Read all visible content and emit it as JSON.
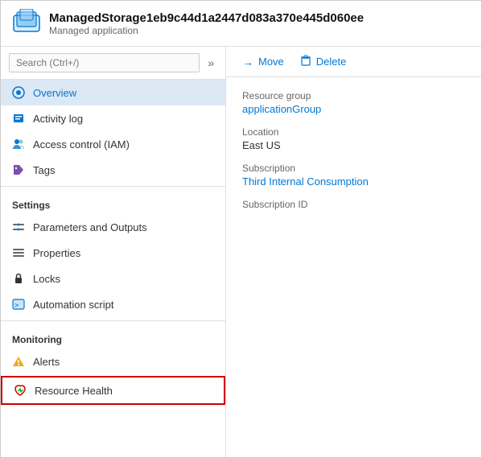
{
  "header": {
    "title": "ManagedStorage1eb9c44d1a2447d083a370e445d060ee",
    "subtitle": "Managed application",
    "icon_label": "managed-application-icon"
  },
  "sidebar": {
    "search_placeholder": "Search (Ctrl+/)",
    "collapse_label": "»",
    "nav_items": [
      {
        "id": "overview",
        "label": "Overview",
        "icon": "overview",
        "active": true,
        "highlighted": false
      },
      {
        "id": "activity-log",
        "label": "Activity log",
        "icon": "activity",
        "active": false,
        "highlighted": false
      },
      {
        "id": "access-control",
        "label": "Access control (IAM)",
        "icon": "iam",
        "active": false,
        "highlighted": false
      },
      {
        "id": "tags",
        "label": "Tags",
        "icon": "tags",
        "active": false,
        "highlighted": false
      }
    ],
    "sections": [
      {
        "label": "Settings",
        "items": [
          {
            "id": "params-outputs",
            "label": "Parameters and Outputs",
            "icon": "params"
          },
          {
            "id": "properties",
            "label": "Properties",
            "icon": "properties"
          },
          {
            "id": "locks",
            "label": "Locks",
            "icon": "locks"
          },
          {
            "id": "automation-script",
            "label": "Automation script",
            "icon": "automation"
          }
        ]
      },
      {
        "label": "Monitoring",
        "items": [
          {
            "id": "alerts",
            "label": "Alerts",
            "icon": "alerts"
          },
          {
            "id": "resource-health",
            "label": "Resource Health",
            "icon": "resource-health",
            "highlighted": true
          }
        ]
      }
    ]
  },
  "toolbar": {
    "move_label": "Move",
    "delete_label": "Delete"
  },
  "info": {
    "resource_group_label": "Resource group",
    "resource_group_value": "applicationGroup",
    "location_label": "Location",
    "location_value": "East US",
    "subscription_label": "Subscription",
    "subscription_value": "Third Internal Consumption",
    "subscription_id_label": "Subscription ID",
    "subscription_id_value": ""
  }
}
